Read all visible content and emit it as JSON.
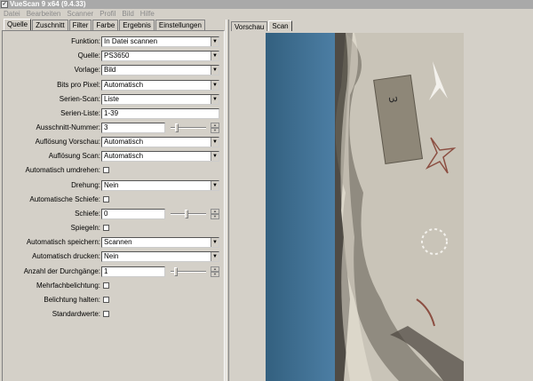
{
  "window": {
    "title": "VueScan 9 x64 (9.4.33)"
  },
  "menu": [
    "Datei",
    "Bearbeiten",
    "Scanner",
    "Profil",
    "Bild",
    "Hilfe"
  ],
  "left_tabs": [
    "Quelle",
    "Zuschnitt",
    "Filter",
    "Farbe",
    "Ergebnis",
    "Einstellungen"
  ],
  "right_tabs": [
    "Vorschau",
    "Scan"
  ],
  "fields": {
    "funktion": {
      "label": "Funktion:",
      "value": "In Datei scannen"
    },
    "quelle": {
      "label": "Quelle:",
      "value": "PS3650"
    },
    "vorlage": {
      "label": "Vorlage:",
      "value": "Bild"
    },
    "bits": {
      "label": "Bits pro Pixel:",
      "value": "Automatisch"
    },
    "serien_scan": {
      "label": "Serien-Scan:",
      "value": "Liste"
    },
    "serien_liste": {
      "label": "Serien-Liste:",
      "value": "1-39"
    },
    "ausschnitt": {
      "label": "Ausschnitt-Nummer:",
      "value": "3"
    },
    "aufl_vorschau": {
      "label": "Auflösung Vorschau:",
      "value": "Automatisch"
    },
    "aufl_scan": {
      "label": "Auflösung Scan:",
      "value": "Automatisch"
    },
    "auto_umdrehen": {
      "label": "Automatisch umdrehen:"
    },
    "drehung": {
      "label": "Drehung:",
      "value": "Nein"
    },
    "auto_schiefe": {
      "label": "Automatische Schiefe:"
    },
    "schiefe": {
      "label": "Schiefe:",
      "value": "0"
    },
    "spiegeln": {
      "label": "Spiegeln:"
    },
    "auto_speichern": {
      "label": "Automatisch speichern:",
      "value": "Scannen"
    },
    "auto_drucken": {
      "label": "Automatisch drucken:",
      "value": "Nein"
    },
    "durchgaenge": {
      "label": "Anzahl der Durchgänge:",
      "value": "1"
    },
    "mehrfach": {
      "label": "Mehrfachbelichtung:"
    },
    "belichtung": {
      "label": "Belichtung halten:"
    },
    "standard": {
      "label": "Standardwerte:"
    }
  },
  "sliders": {
    "ausschnitt": 0.15,
    "schiefe": 0.45,
    "durchgaenge": 0.1
  },
  "colors": {
    "titlebar": "#a9a9a9",
    "sky": "#3f6f96",
    "sand": "#c9c4b8"
  }
}
